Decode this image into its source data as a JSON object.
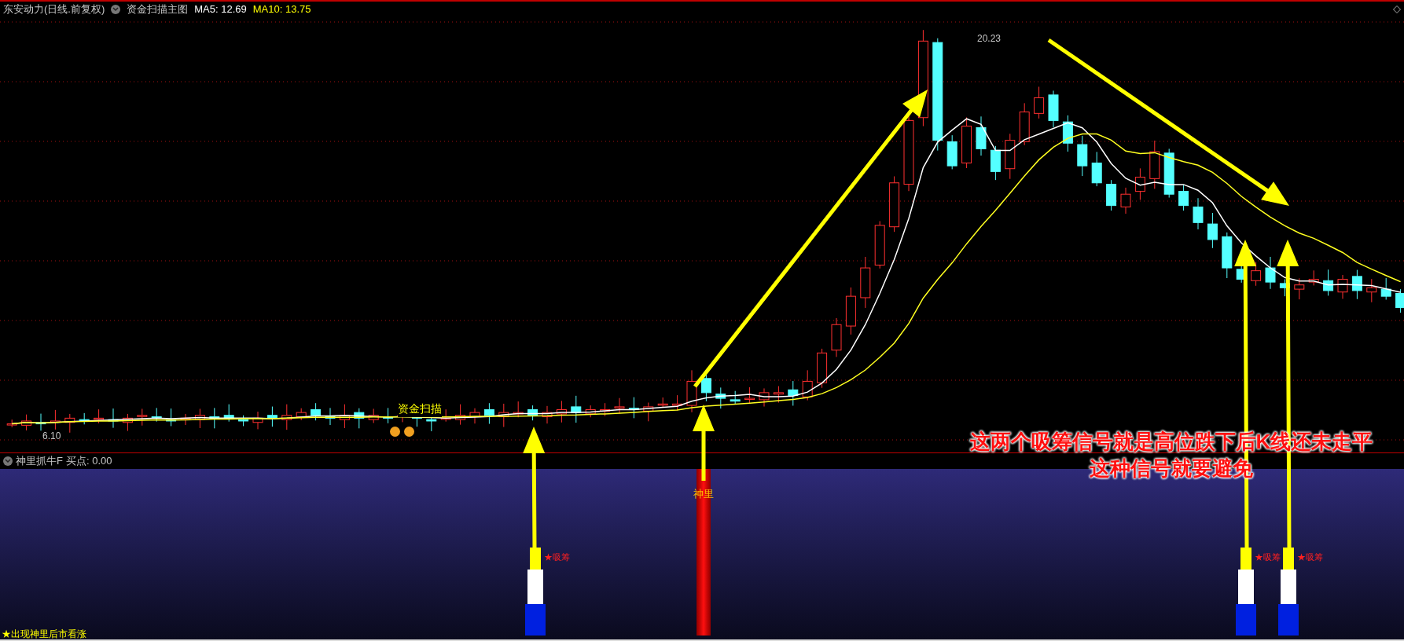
{
  "header": {
    "title": "东安动力(日线.前复权)",
    "indicator": "资金扫描主图",
    "ma5": "MA5: 12.69",
    "ma10": "MA10: 13.75"
  },
  "main_chart": {
    "high_label": "20.23",
    "low_label": "6.10",
    "signal_label": "资金扫描"
  },
  "annotation": {
    "lines": [
      "这两个吸筹信号就是高位跌下后K线还未走平",
      "这种信号就要避免"
    ]
  },
  "sub_header": {
    "indicator": "神里抓牛F",
    "reading": "买点: 0.00"
  },
  "sub_chart": {
    "bars": [
      {
        "kind": "accumulate",
        "label": "★吸筹"
      },
      {
        "kind": "shenli",
        "label": "神里"
      },
      {
        "kind": "accumulate",
        "label": "★吸筹"
      },
      {
        "kind": "accumulate",
        "label": "★吸筹"
      }
    ]
  },
  "footer": "★出现神里后市看涨"
}
